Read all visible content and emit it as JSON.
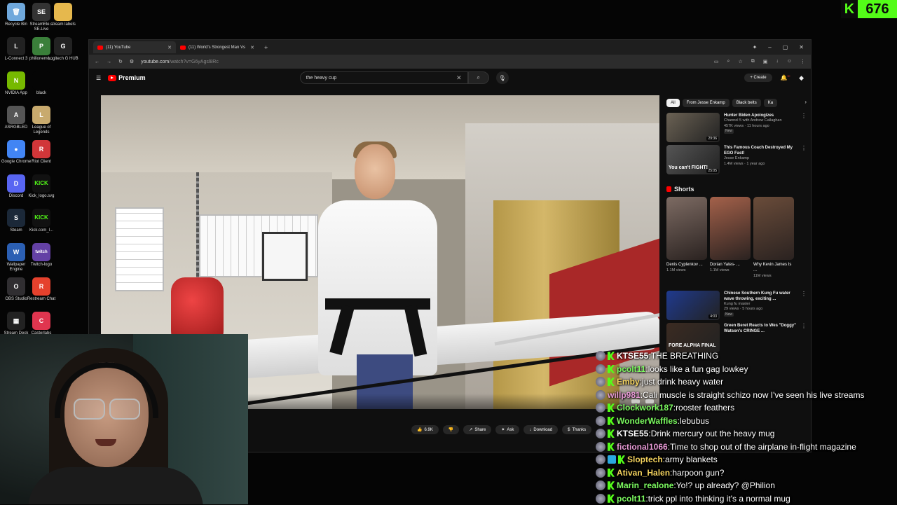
{
  "desktop": {
    "icons": [
      {
        "label": "Recycle Bin",
        "color": "#6fa8dc",
        "glyph": "🗑"
      },
      {
        "label": "StreamEle... SE.Live",
        "color": "#333",
        "glyph": "SE"
      },
      {
        "label": "stream labels",
        "color": "#e6b84d",
        "glyph": ""
      },
      {
        "label": "L-Connect 3",
        "color": "#222",
        "glyph": "L"
      },
      {
        "label": "philionemo...",
        "color": "#3a7f3a",
        "glyph": "P"
      },
      {
        "label": "Logitech G HUB",
        "color": "#222",
        "glyph": "G"
      },
      {
        "label": "NVIDIA App",
        "color": "#76b900",
        "glyph": "N"
      },
      {
        "label": "black",
        "color": "#050505",
        "glyph": ""
      },
      {
        "label": "ASRGBLED",
        "color": "#555",
        "glyph": "A"
      },
      {
        "label": "League of Legends",
        "color": "#c8aa6e",
        "glyph": "L"
      },
      {
        "label": "Google Chrome",
        "color": "#4285f4",
        "glyph": "●"
      },
      {
        "label": "Riot Client",
        "color": "#d13639",
        "glyph": "R"
      },
      {
        "label": "Discord",
        "color": "#5865f2",
        "glyph": "D"
      },
      {
        "label": "Kick_logo.svg",
        "color": "#111",
        "glyph": "KICK"
      },
      {
        "label": "Steam",
        "color": "#1b2838",
        "glyph": "S"
      },
      {
        "label": "Kick.com_l...",
        "color": "#111",
        "glyph": "KICK"
      },
      {
        "label": "Wallpaper Engine",
        "color": "#2b5fb3",
        "glyph": "W"
      },
      {
        "label": "Twitch-logo",
        "color": "#111",
        "glyph": "twitch"
      },
      {
        "label": "OBS Studio",
        "color": "#302e31",
        "glyph": "O"
      },
      {
        "label": "Restream Chat",
        "color": "#e5412d",
        "glyph": "R"
      },
      {
        "label": "Stream Deck",
        "color": "#222",
        "glyph": "▦"
      },
      {
        "label": "Casterlabs",
        "color": "#e0354f",
        "glyph": "C"
      }
    ]
  },
  "kick_counter": {
    "value": "676",
    "logo": "K"
  },
  "browser": {
    "tabs": [
      {
        "label": "(11) YouTube"
      },
      {
        "label": "(11) World's Strongest Man Vs"
      }
    ],
    "new_tab": "+",
    "window_controls": {
      "minimize": "–",
      "maximize": "▢",
      "close": "✕"
    },
    "url": "youtube.com",
    "url_rest": "/watch?v=G6yAgsl8Rc"
  },
  "youtube": {
    "logo": "Premium",
    "search_value": "the heavy cup",
    "create_label": "Create",
    "notification_count": "9+",
    "actions": [
      {
        "icon": "👍",
        "label": "6.9K"
      },
      {
        "icon": "👎",
        "label": ""
      },
      {
        "icon": "↗",
        "label": "Share"
      },
      {
        "icon": "✦",
        "label": "Ask"
      },
      {
        "icon": "↓",
        "label": "Download"
      },
      {
        "icon": "$",
        "label": "Thanks"
      }
    ],
    "chips": [
      "All",
      "From Jesse Enkamp",
      "Black belts",
      "Ka"
    ],
    "recs": [
      {
        "title": "Hunter Biden Apologizes",
        "channel": "Channel 5 with Andrew Callaghan",
        "views": "457K views · 11 hours ago",
        "badge": "New",
        "duration": "29:36",
        "overlay": "",
        "color": "#6b6254"
      },
      {
        "title": "This Famous Coach Destroyed My EGO Fast!",
        "channel": "Jesse Enkamp",
        "views": "1.4M views · 1 year ago",
        "badge": "",
        "duration": "25:05",
        "overlay": "You can't FIGHT!",
        "color": "#555"
      }
    ],
    "shorts_title": "Shorts",
    "shorts": [
      {
        "title": "Denis Cyplenkov ...",
        "views": "1.1M views",
        "color": "#7d6b63"
      },
      {
        "title": "Dorian Yates- ...",
        "views": "1.1M views",
        "color": "#a4614a"
      },
      {
        "title": "Why Kevin James Is ...",
        "views": "11M views",
        "color": "#6a4c3a"
      }
    ],
    "recs2": [
      {
        "title": "Chinese Southern Kung Fu water wave throwing, exciting ...",
        "channel": "Kung fu master",
        "views": "29 views · 5 hours ago",
        "badge": "New",
        "duration": "4:03",
        "overlay": "",
        "color": "#1f3a8f"
      },
      {
        "title": "Green Beret Reacts to Wes \"Doggy\" Watson's CRINGE ...",
        "channel": "",
        "views": "",
        "badge": "",
        "duration": "",
        "overlay": "FORE ALPHA FINAL",
        "color": "#3b2b22"
      }
    ]
  },
  "chat": {
    "messages": [
      {
        "user": "KTSE55",
        "color": "#ffffff",
        "text": "THE BREATHING",
        "badges": [
          "round",
          "kick"
        ]
      },
      {
        "user": "pcolt11",
        "color": "#7cfc60",
        "text": "looks like a fun gag lowkey",
        "badges": [
          "round",
          "kick"
        ]
      },
      {
        "user": "Emby",
        "color": "#f4d35e",
        "text": "just drink heavy water",
        "badges": [
          "round",
          "kick"
        ]
      },
      {
        "user": "willp981",
        "color": "#e89ad6",
        "text": "Cali muscle is straight schizo now I've seen his live streams",
        "badges": [
          "round"
        ]
      },
      {
        "user": "Clockwork187",
        "color": "#7cfc60",
        "text": "rooster feathers",
        "badges": [
          "round",
          "kick"
        ]
      },
      {
        "user": "WonderWaffles",
        "color": "#7cfc60",
        "text": "lebubus",
        "badges": [
          "round",
          "kick"
        ]
      },
      {
        "user": "KTSE55",
        "color": "#ffffff",
        "text": "Drink mercury out the heavy mug",
        "badges": [
          "round",
          "kick"
        ]
      },
      {
        "user": "fictional1066",
        "color": "#e89ad6",
        "text": "Time to shop out of the airplane in-flight magazine",
        "badges": [
          "round",
          "kick"
        ]
      },
      {
        "user": "Sloptech",
        "color": "#f4d35e",
        "text": "army blankets",
        "badges": [
          "round",
          "blue",
          "kick"
        ]
      },
      {
        "user": "Ativan_Halen",
        "color": "#f4d35e",
        "text": "harpoon gun?",
        "badges": [
          "round",
          "kick"
        ]
      },
      {
        "user": "Marin_realone",
        "color": "#7cfc60",
        "text": "Yo!? up already? @Philion",
        "badges": [
          "round",
          "kick"
        ]
      },
      {
        "user": "pcolt11",
        "color": "#7cfc60",
        "text": "trick ppl into thinking it's a normal mug",
        "badges": [
          "round",
          "kick"
        ]
      }
    ]
  }
}
